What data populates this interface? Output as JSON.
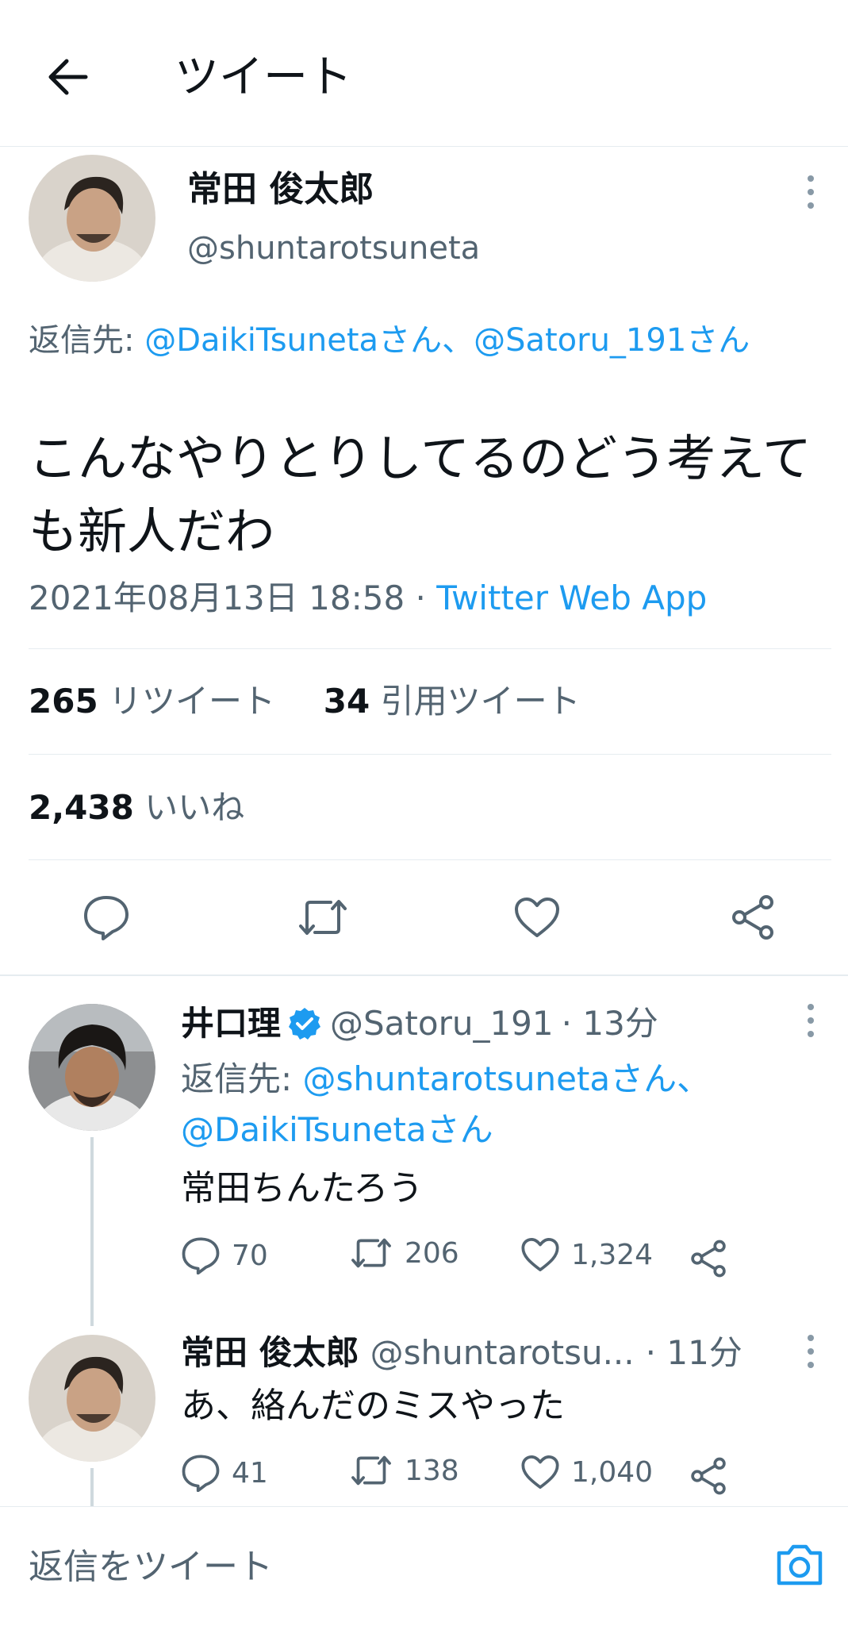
{
  "header": {
    "title": "ツイート",
    "back_icon": "arrow-left-icon"
  },
  "main_tweet": {
    "author_name": "常田 俊太郎",
    "author_handle": "@shuntarotsuneta",
    "reply_prefix": "返信先:",
    "reply_targets": "@DaikiTsunetaさん、@Satoru_191さん",
    "text": "こんなやりとりしてるのどう考えても新人だわ",
    "timestamp": "2021年08月13日 18:58",
    "separator": " · ",
    "source": "Twitter Web App",
    "retweets_count": "265",
    "retweets_label": "リツイート",
    "quotes_count": "34",
    "quotes_label": "引用ツイート",
    "likes_count": "2,438",
    "likes_label": "いいね"
  },
  "replies": [
    {
      "author_name": "井口理",
      "verified": true,
      "author_handle": "@Satoru_191",
      "time": "· 13分",
      "reply_prefix": "返信先:",
      "reply_targets_line1": "@shuntarotsunetaさん、",
      "reply_targets_line2": "@DaikiTsunetaさん",
      "text": "常田ちんたろう",
      "reply_count": "70",
      "retweet_count": "206",
      "like_count": "1,324"
    },
    {
      "author_name": "常田 俊太郎",
      "author_handle": "@shuntarotsu...",
      "time": "· 11分",
      "text": "あ、絡んだのミスやった",
      "reply_count": "41",
      "retweet_count": "138",
      "like_count": "1,040"
    }
  ],
  "composer": {
    "placeholder": "返信をツイート",
    "camera_icon": "camera-icon"
  },
  "colors": {
    "accent": "#1d9bf0",
    "text": "#0f1419",
    "muted": "#536471",
    "divider": "#e6ecf0"
  }
}
